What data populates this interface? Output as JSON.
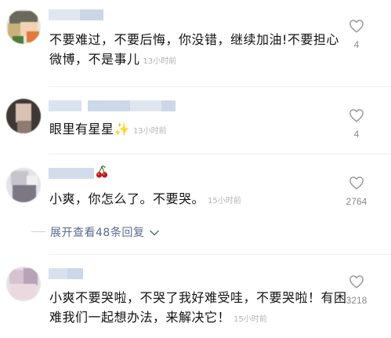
{
  "comments": [
    {
      "text": "不要难过，不要后悔，你没错，继续加油!不要担心微博，不是事儿",
      "time": "13小时前",
      "likes": "4"
    },
    {
      "text": "眼里有星星✨",
      "time": "13小时前",
      "likes": "4"
    },
    {
      "text": "小爽，你怎么了。不要哭。",
      "time": "15小时前",
      "likes": "2764",
      "expand_label": "展开查看48条回复"
    },
    {
      "text": "小爽不要哭啦，不哭了我好难受哇，不要哭啦！有困难我们一起想办法，来解决它！",
      "time": "15小时前",
      "likes": "3218"
    }
  ],
  "colors": {
    "link": "#5a6b8c",
    "muted": "#b4b4b4",
    "likeIcon": "#9a9a9a"
  },
  "icons": {
    "like": "heart-outline-icon",
    "expand": "chevron-down-icon",
    "cherry": "cherry-emoji"
  }
}
